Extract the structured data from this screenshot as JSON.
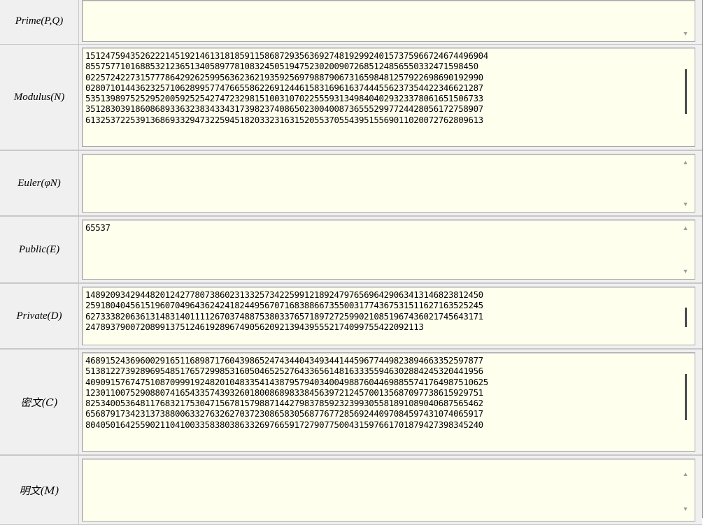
{
  "fields": {
    "prime": {
      "label": "Prime(P,Q)",
      "value": ""
    },
    "modulus": {
      "label": "Modulus(N)",
      "lines": [
        "1512475943526222145192146131818591158687293563692748192992401573759667246744969​04",
        "8557577101688532123651340589778108324505194752302009072685124856550332471598450",
        "0225724227315777864292625995636236219359256979887906731659848125792269869019299​0",
        "0280710144362325710628995774766558622691244615831696163744455623735442234662128​7",
        "5351398975252952005925254274723298151003107022555931349840402932337806165150673​3",
        "3512830391860868933632383433431739823740865023004008736555299772442805617275890​7",
        "6132537225391368693329473225945182033231631520553705543951556901102007276280961​3"
      ]
    },
    "euler": {
      "label": "Euler(φN)",
      "value": ""
    },
    "public": {
      "label": "Public(E)",
      "value": "65537"
    },
    "private": {
      "label": "Private(D)",
      "lines": [
        "1489209342944820124277807386023133257342259912189247976569642906341314682381245​0",
        "2591804045615196070496436242418244956707168388667355003177436753151162716352524​5",
        "6273338206361314831401111267037488753803376571897272599021085196743602174564317​1",
        "2478937900720899137512461928967490562092139439555217409975542209211​3"
      ]
    },
    "cipher": {
      "label": "密文(C)",
      "lines": [
        "4689152436960029165116898717604398652474344043493441445967744982389466335259787​7",
        "5138122739289695485176572998531605046525276433656148163335594630288424532044195​6",
        "4090915767475108709991924820104833541438795794034004988760446988557417649875106​25",
        "1230110075290880741654335743932601800868983384563972124570013568709773861592975​1",
        "8253400536481176832175304715678157988714427983785923239930558189108904068756546​2",
        "6568791734231373880063327632627037230865830568776772856924409708459743107406591​7",
        "8040501642559021104100335838038633269766591727907750043159766170187942739834524​0"
      ]
    },
    "plain": {
      "label": "明文(M)",
      "value": ""
    }
  }
}
